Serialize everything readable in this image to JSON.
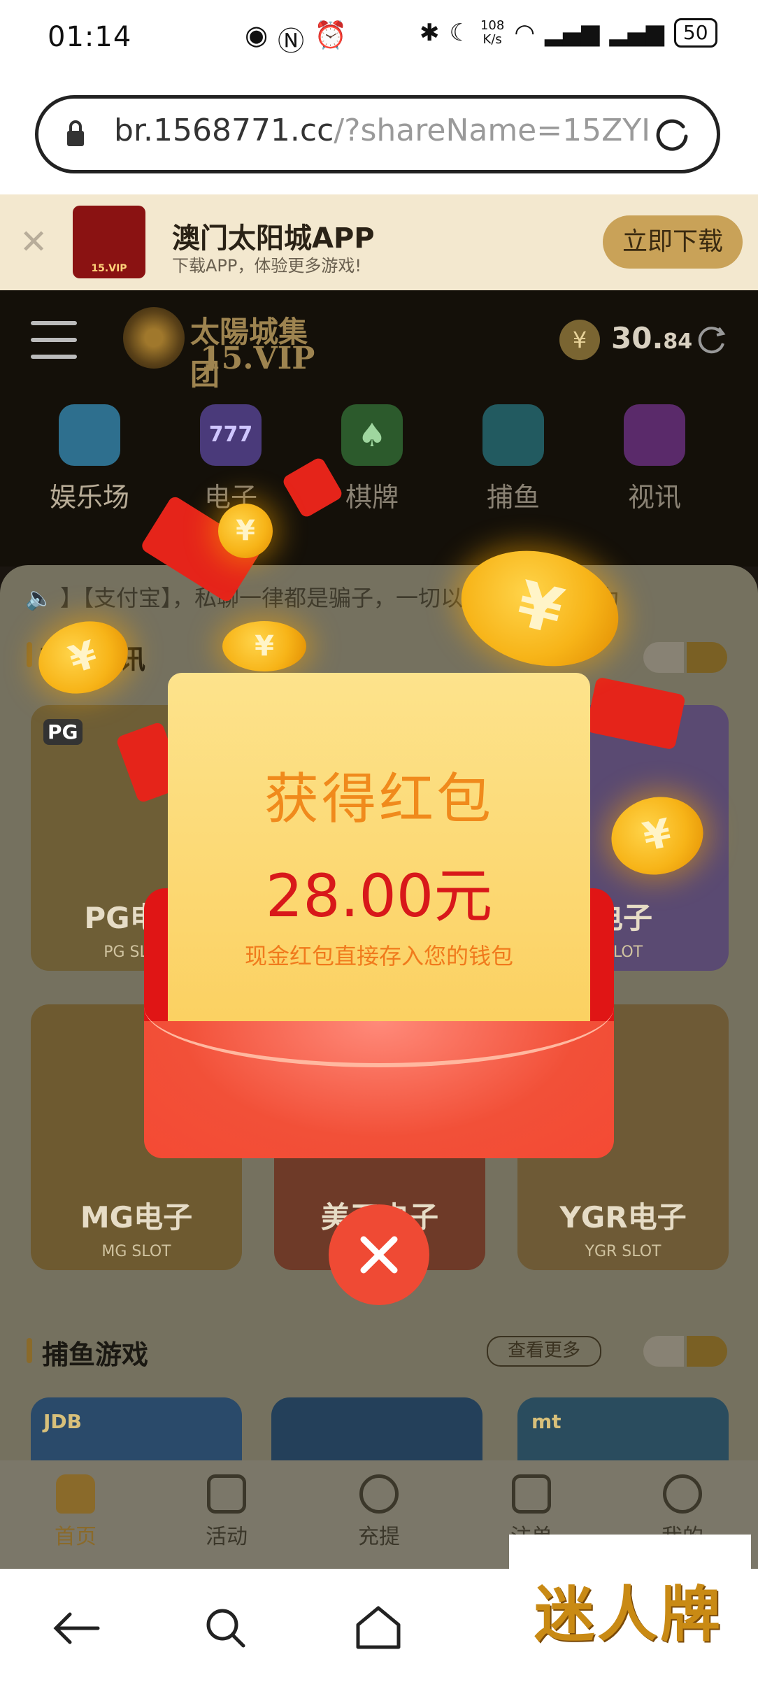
{
  "status_bar": {
    "time": "01:14",
    "net_speed_top": "108",
    "net_speed_bottom": "K/s",
    "battery": "50"
  },
  "url_bar": {
    "host": "br.1568771.cc",
    "path": "/?shareName=15ZYI"
  },
  "app_banner": {
    "title": "澳门太阳城APP",
    "subtitle": "下载APP，体验更多游戏!",
    "button": "立即下载",
    "logo_label": "15.VIP"
  },
  "header": {
    "brand_line1": "太陽城集团",
    "brand_line2": "15.VIP",
    "currency_symbol": "¥",
    "balance_int": "30.",
    "balance_dec": "84"
  },
  "categories": [
    {
      "label": "娱乐场",
      "active": true
    },
    {
      "label": "电子"
    },
    {
      "label": "棋牌"
    },
    {
      "label": "捕鱼"
    },
    {
      "label": "视讯"
    }
  ],
  "marquee": "】【支付宝】，私聊一律都是骗子，一切以官方在线客服为",
  "section1": {
    "title": "真人视讯"
  },
  "slot_cards_row1": [
    {
      "tag": "PG",
      "name": "PG电子",
      "sub": "PG SLOT"
    },
    {
      "name": "",
      "sub": ""
    },
    {
      "name": "电子",
      "sub": "SLOT"
    }
  ],
  "slot_cards_row2": [
    {
      "name": "MG电子",
      "sub": "MG SLOT"
    },
    {
      "name": "美天电子",
      "sub": ""
    },
    {
      "name": "YGR电子",
      "sub": "YGR SLOT"
    }
  ],
  "section2": {
    "title": "捕鱼游戏",
    "more": "查看更多"
  },
  "fish_cards": [
    {
      "tag": "JDB"
    },
    {
      "tag": ""
    },
    {
      "tag": "mt"
    }
  ],
  "tabs": [
    {
      "label": "首页",
      "active": true
    },
    {
      "label": "活动"
    },
    {
      "label": "充提"
    },
    {
      "label": "注单"
    },
    {
      "label": "我的"
    }
  ],
  "modal": {
    "title": "获得红包",
    "amount": "28.00元",
    "description": "现金红包直接存入您的钱包",
    "coin_symbol": "¥"
  },
  "watermark": "迷人牌",
  "colors": {
    "modal_title": "#f08a1c",
    "modal_amount": "#d8181a",
    "envelope_red": "#e01515",
    "gold_accent": "#8a6a2a"
  }
}
